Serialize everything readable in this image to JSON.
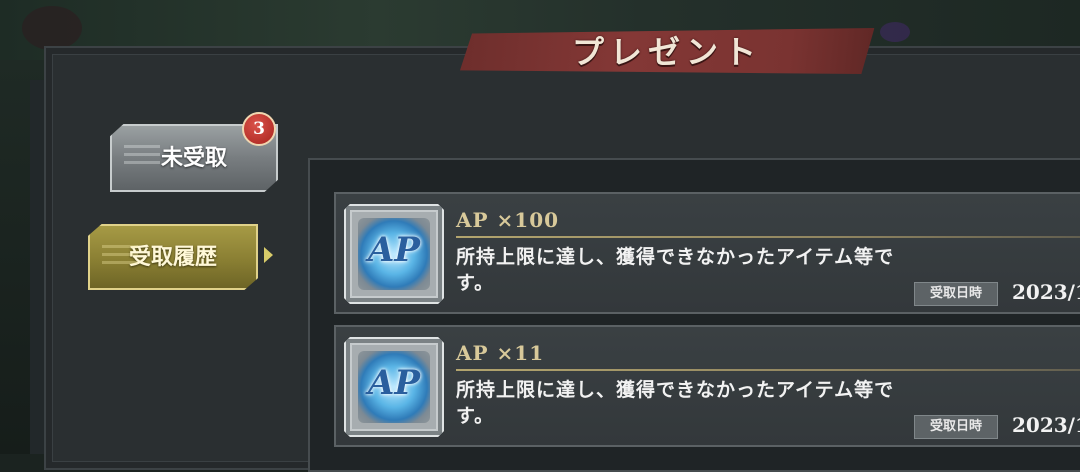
{
  "title": "プレゼント",
  "tabs": {
    "unreceived": {
      "label": "未受取",
      "badge": "3"
    },
    "history": {
      "label": "受取履歴"
    }
  },
  "items": [
    {
      "name": "AP ×100",
      "icon": "ap-icon",
      "icon_text": "AP",
      "description": "所持上限に達し、獲得できなかったアイテム等です。",
      "date_label": "受取日時",
      "date_value": "2023/1"
    },
    {
      "name": "AP ×11",
      "icon": "ap-icon",
      "icon_text": "AP",
      "description": "所持上限に達し、獲得できなかったアイテム等です。",
      "date_label": "受取日時",
      "date_value": "2023/1"
    }
  ],
  "colors": {
    "title_banner": "#7a3331",
    "active_tab": "#8a7f33",
    "inactive_tab": "#787d80",
    "badge": "#c0312a",
    "item_name": "#d8c99a"
  }
}
